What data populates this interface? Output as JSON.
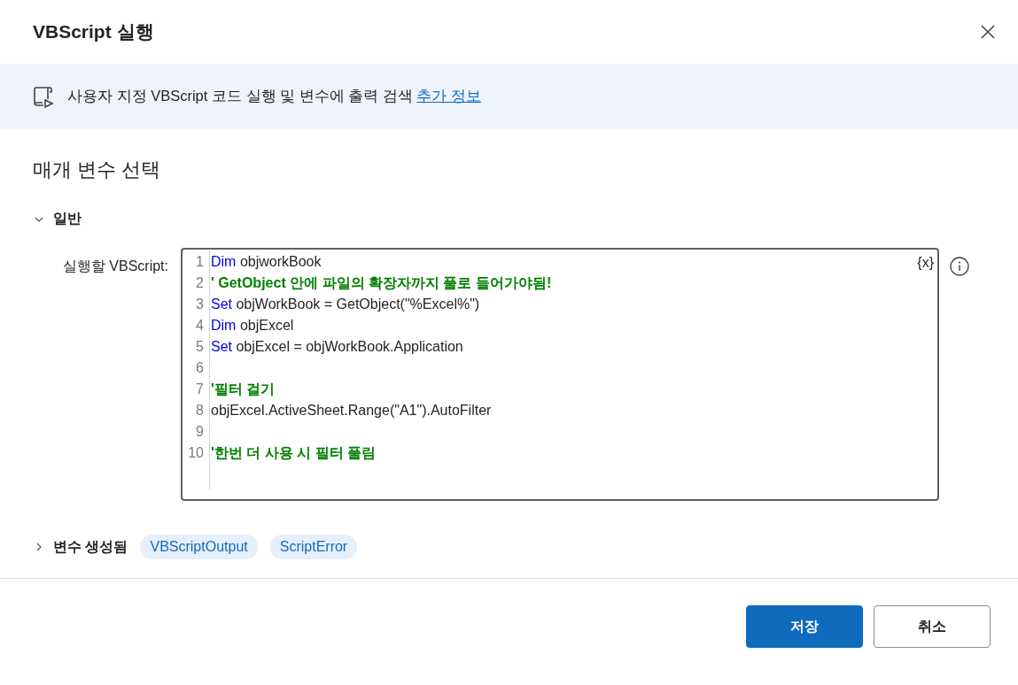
{
  "dialog": {
    "title": "VBScript 실행"
  },
  "info_banner": {
    "text": "사용자 지정 VBScript 코드 실행 및 변수에 출력 검색",
    "link": "추가 정보"
  },
  "heading": "매개 변수 선택",
  "general_section": {
    "label": "일반",
    "expanded": true,
    "field_label": "실행할 VBScript:",
    "variable_button": "{x}",
    "code_lines": [
      {
        "number": "1",
        "tokens": [
          {
            "kind": "keyword",
            "text": "Dim"
          },
          {
            "kind": "plain",
            "text": " objworkBook"
          }
        ]
      },
      {
        "number": "2",
        "tokens": [
          {
            "kind": "comment",
            "text": "' GetObject 안에 파일의 확장자까지 풀로 들어가야됨!"
          }
        ]
      },
      {
        "number": "3",
        "tokens": [
          {
            "kind": "keyword",
            "text": "Set"
          },
          {
            "kind": "plain",
            "text": " objWorkBook = GetObject(\"%Excel%\")"
          }
        ]
      },
      {
        "number": "4",
        "tokens": [
          {
            "kind": "keyword",
            "text": "Dim"
          },
          {
            "kind": "plain",
            "text": " objExcel"
          }
        ]
      },
      {
        "number": "5",
        "tokens": [
          {
            "kind": "keyword",
            "text": "Set"
          },
          {
            "kind": "plain",
            "text": " objExcel = objWorkBook.Application"
          }
        ]
      },
      {
        "number": "6"
      },
      {
        "number": "7",
        "tokens": [
          {
            "kind": "comment",
            "text": "'필터 걸기"
          }
        ]
      },
      {
        "number": "8",
        "tokens": [
          {
            "kind": "plain",
            "text": "objExcel.ActiveSheet.Range(\"A1\").AutoFilter"
          }
        ]
      },
      {
        "number": "9"
      },
      {
        "number": "10",
        "tokens": [
          {
            "kind": "comment",
            "text": "'한번 더 사용 시 필터 풀림"
          }
        ]
      }
    ]
  },
  "variables_section": {
    "label": "변수 생성됨",
    "expanded": false,
    "variables": [
      "VBScriptOutput",
      "ScriptError"
    ]
  },
  "buttons": [
    {
      "label": "저장",
      "kind": "primary"
    },
    {
      "label": "취소",
      "kind": "secondary"
    }
  ]
}
